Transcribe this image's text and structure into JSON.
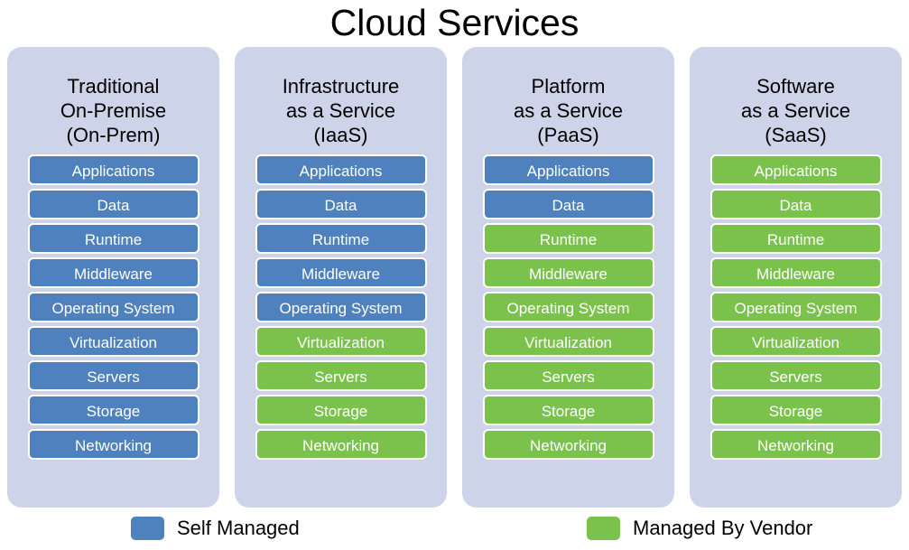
{
  "title": "Cloud Services",
  "colors": {
    "self_managed": "#4E81BD",
    "managed_by_vendor": "#7BC24C",
    "panel_background": "#CDD3E8",
    "page_background": "#FFFFFF",
    "row_text": "#FFFFFF",
    "title_text": "#000000"
  },
  "layer_names": [
    "Applications",
    "Data",
    "Runtime",
    "Middleware",
    "Operating System",
    "Virtualization",
    "Servers",
    "Storage",
    "Networking"
  ],
  "columns": [
    {
      "id": "on-prem",
      "header_line1": "Traditional",
      "header_line2": "On-Premise",
      "header_line3": "(On-Prem)",
      "layers": [
        {
          "label": "Applications",
          "owner": "self"
        },
        {
          "label": "Data",
          "owner": "self"
        },
        {
          "label": "Runtime",
          "owner": "self"
        },
        {
          "label": "Middleware",
          "owner": "self"
        },
        {
          "label": "Operating System",
          "owner": "self"
        },
        {
          "label": "Virtualization",
          "owner": "self"
        },
        {
          "label": "Servers",
          "owner": "self"
        },
        {
          "label": "Storage",
          "owner": "self"
        },
        {
          "label": "Networking",
          "owner": "self"
        }
      ]
    },
    {
      "id": "iaas",
      "header_line1": "Infrastructure",
      "header_line2": "as a Service",
      "header_line3": "(IaaS)",
      "layers": [
        {
          "label": "Applications",
          "owner": "self"
        },
        {
          "label": "Data",
          "owner": "self"
        },
        {
          "label": "Runtime",
          "owner": "self"
        },
        {
          "label": "Middleware",
          "owner": "self"
        },
        {
          "label": "Operating System",
          "owner": "self"
        },
        {
          "label": "Virtualization",
          "owner": "vendor"
        },
        {
          "label": "Servers",
          "owner": "vendor"
        },
        {
          "label": "Storage",
          "owner": "vendor"
        },
        {
          "label": "Networking",
          "owner": "vendor"
        }
      ]
    },
    {
      "id": "paas",
      "header_line1": "Platform",
      "header_line2": "as a Service",
      "header_line3": "(PaaS)",
      "layers": [
        {
          "label": "Applications",
          "owner": "self"
        },
        {
          "label": "Data",
          "owner": "self"
        },
        {
          "label": "Runtime",
          "owner": "vendor"
        },
        {
          "label": "Middleware",
          "owner": "vendor"
        },
        {
          "label": "Operating System",
          "owner": "vendor"
        },
        {
          "label": "Virtualization",
          "owner": "vendor"
        },
        {
          "label": "Servers",
          "owner": "vendor"
        },
        {
          "label": "Storage",
          "owner": "vendor"
        },
        {
          "label": "Networking",
          "owner": "vendor"
        }
      ]
    },
    {
      "id": "saas",
      "header_line1": "Software",
      "header_line2": "as a Service",
      "header_line3": "(SaaS)",
      "layers": [
        {
          "label": "Applications",
          "owner": "vendor"
        },
        {
          "label": "Data",
          "owner": "vendor"
        },
        {
          "label": "Runtime",
          "owner": "vendor"
        },
        {
          "label": "Middleware",
          "owner": "vendor"
        },
        {
          "label": "Operating System",
          "owner": "vendor"
        },
        {
          "label": "Virtualization",
          "owner": "vendor"
        },
        {
          "label": "Servers",
          "owner": "vendor"
        },
        {
          "label": "Storage",
          "owner": "vendor"
        },
        {
          "label": "Networking",
          "owner": "vendor"
        }
      ]
    }
  ],
  "legend": [
    {
      "id": "self",
      "label": "Self Managed",
      "color": "#4E81BD"
    },
    {
      "id": "vendor",
      "label": "Managed By Vendor",
      "color": "#7BC24C"
    }
  ]
}
